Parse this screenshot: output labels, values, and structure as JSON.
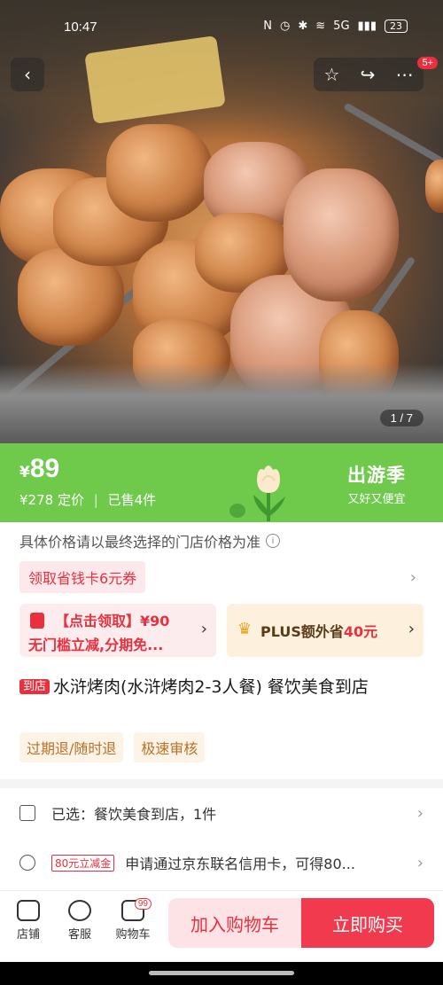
{
  "status_bar": {
    "time": "10:47",
    "network": "5G",
    "battery": "23"
  },
  "gallery": {
    "current": "1",
    "total": "7",
    "share_badge": "5+"
  },
  "price": {
    "currency": "¥",
    "current": "89",
    "original": "¥278",
    "original_label": "定价",
    "sold": "已售4件",
    "promo_title": "出游季",
    "promo_sub": "又好又便宜"
  },
  "notice": "具体价格请以最终选择的门店价格为准",
  "coupon": {
    "label": "领取省钱卡6元券"
  },
  "offers": {
    "left_line1": "【点击领取】¥90",
    "left_line2": "无门槛立减,分期免...",
    "right_prefix": "PLUS额外省",
    "right_amount": "40元"
  },
  "product": {
    "tag": "到店",
    "title": "水浒烤肉(水浒烤肉2-3人餐) 餐饮美食到店",
    "service_tags": [
      "过期退/随时退",
      "极速审核"
    ]
  },
  "rows": {
    "selected": "已选：餐饮美食到店，1件",
    "credit_tag": "80元立减金",
    "credit_text": "申请通过京东联名信用卡，可得80..."
  },
  "bottom_bar": {
    "store": "店铺",
    "service": "客服",
    "cart": "购物车",
    "cart_count": "99",
    "add_to_cart": "加入购物车",
    "buy_now": "立即购买"
  },
  "colors": {
    "accent_red": "#e8303e",
    "banner_green": "#6fc94a",
    "buy_button": "#f23a4e"
  }
}
